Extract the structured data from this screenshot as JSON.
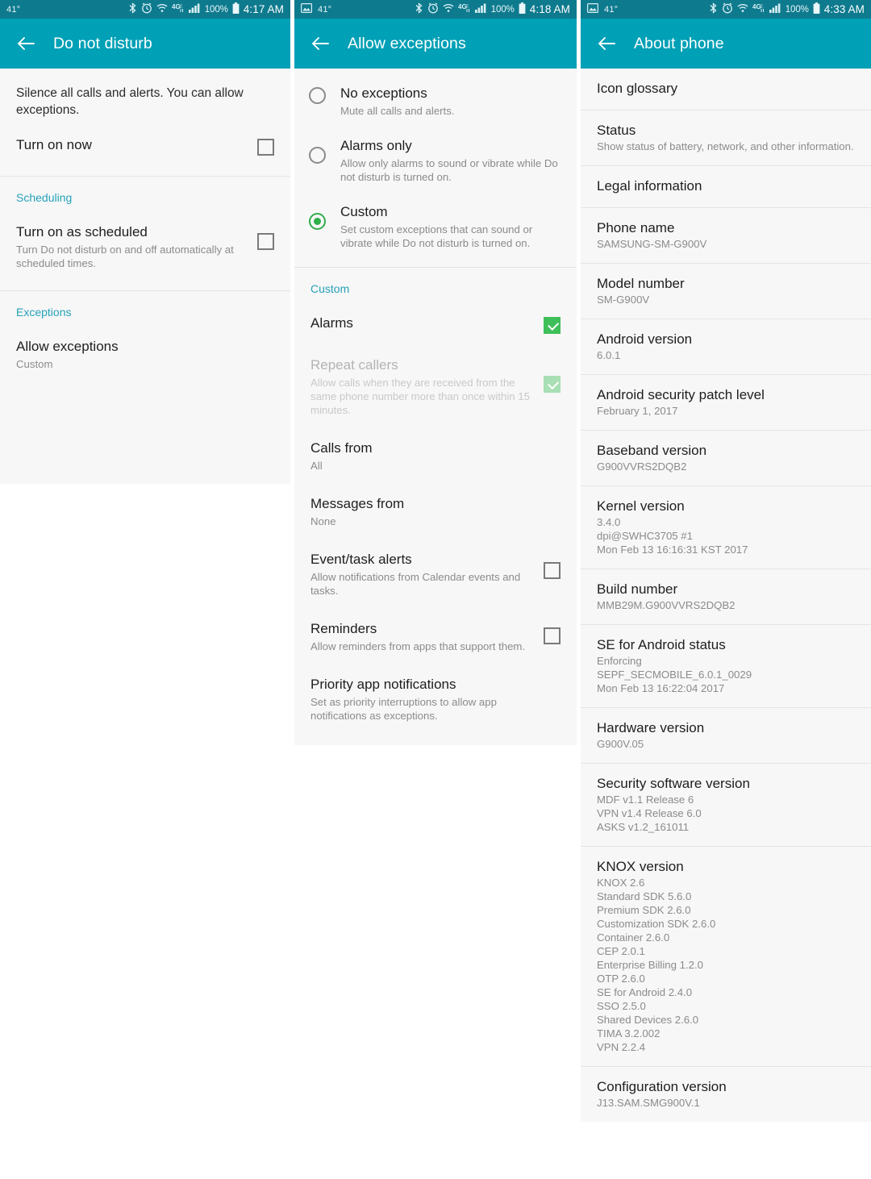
{
  "panels": [
    {
      "statusbar": {
        "temp": "41°",
        "has_image_icon": false,
        "battery_pct": "100%",
        "time": "4:17 AM",
        "icons": [
          "bluetooth-icon",
          "alarm-icon",
          "wifi-icon",
          "4g-lte-icon",
          "signal-icon",
          "battery-icon"
        ]
      },
      "appbar": {
        "title": "Do not disturb",
        "back_label": "←"
      },
      "intro": "Silence all calls and alerts. You can allow exceptions.",
      "rows": [
        {
          "title": "Turn on now",
          "subtitle": "",
          "control": "checkbox",
          "checked": false
        }
      ],
      "sections": [
        {
          "header": "Scheduling",
          "rows": [
            {
              "title": "Turn on as scheduled",
              "subtitle": "Turn Do not disturb on and off automatically at scheduled times.",
              "control": "checkbox",
              "checked": false
            }
          ]
        },
        {
          "header": "Exceptions",
          "rows": [
            {
              "title": "Allow exceptions",
              "subtitle": "Custom",
              "control": "none",
              "checked": false
            }
          ]
        }
      ]
    },
    {
      "statusbar": {
        "temp": "41°",
        "has_image_icon": true,
        "battery_pct": "100%",
        "time": "4:18 AM",
        "icons": [
          "image-icon",
          "bluetooth-icon",
          "alarm-icon",
          "wifi-icon",
          "4g-lte-icon",
          "signal-icon",
          "battery-icon"
        ]
      },
      "appbar": {
        "title": "Allow exceptions",
        "back_label": "←"
      },
      "radios": [
        {
          "title": "No exceptions",
          "subtitle": "Mute all calls and alerts.",
          "selected": false
        },
        {
          "title": "Alarms only",
          "subtitle": "Allow only alarms to sound or vibrate while Do not disturb is turned on.",
          "selected": false
        },
        {
          "title": "Custom",
          "subtitle": "Set custom exceptions that can sound or vibrate while Do not disturb is turned on.",
          "selected": true
        }
      ],
      "custom_header": "Custom",
      "custom_rows": [
        {
          "title": "Alarms",
          "subtitle": "",
          "control": "checkbox",
          "checked": true,
          "disabled": false
        },
        {
          "title": "Repeat callers",
          "subtitle": "Allow calls when they are received from the same phone number more than once within 15 minutes.",
          "control": "checkbox",
          "checked": true,
          "disabled": true
        },
        {
          "title": "Calls from",
          "subtitle": "All",
          "control": "none",
          "checked": false,
          "disabled": false
        },
        {
          "title": "Messages from",
          "subtitle": "None",
          "control": "none",
          "checked": false,
          "disabled": false
        },
        {
          "title": "Event/task alerts",
          "subtitle": "Allow notifications from Calendar events and tasks.",
          "control": "checkbox",
          "checked": false,
          "disabled": false
        },
        {
          "title": "Reminders",
          "subtitle": "Allow reminders from apps that support them.",
          "control": "checkbox",
          "checked": false,
          "disabled": false
        },
        {
          "title": "Priority app notifications",
          "subtitle": "Set as priority interruptions to allow app notifications as exceptions.",
          "control": "none",
          "checked": false,
          "disabled": false
        }
      ]
    },
    {
      "statusbar": {
        "temp": "41°",
        "has_image_icon": true,
        "battery_pct": "100%",
        "time": "4:33 AM",
        "icons": [
          "image-icon",
          "bluetooth-icon",
          "alarm-icon",
          "wifi-icon",
          "4g-lte-icon",
          "signal-icon",
          "battery-icon"
        ]
      },
      "appbar": {
        "title": "About phone",
        "back_label": "←"
      },
      "rows": [
        {
          "title": "Icon glossary",
          "lines": []
        },
        {
          "title": "Status",
          "lines": [
            "Show status of battery, network, and other information."
          ]
        },
        {
          "title": "Legal information",
          "lines": []
        },
        {
          "title": "Phone name",
          "lines": [
            "SAMSUNG-SM-G900V"
          ]
        },
        {
          "title": "Model number",
          "lines": [
            "SM-G900V"
          ]
        },
        {
          "title": "Android version",
          "lines": [
            "6.0.1"
          ]
        },
        {
          "title": "Android security patch level",
          "lines": [
            "February 1, 2017"
          ]
        },
        {
          "title": "Baseband version",
          "lines": [
            "G900VVRS2DQB2"
          ]
        },
        {
          "title": "Kernel version",
          "lines": [
            "3.4.0",
            "dpi@SWHC3705 #1",
            "Mon Feb 13 16:16:31 KST 2017"
          ]
        },
        {
          "title": "Build number",
          "lines": [
            "MMB29M.G900VVRS2DQB2"
          ]
        },
        {
          "title": "SE for Android status",
          "lines": [
            "Enforcing",
            "SEPF_SECMOBILE_6.0.1_0029",
            "Mon Feb 13 16:22:04 2017"
          ]
        },
        {
          "title": "Hardware version",
          "lines": [
            "G900V.05"
          ]
        },
        {
          "title": "Security software version",
          "lines": [
            "MDF v1.1 Release 6",
            "VPN v1.4 Release 6.0",
            "ASKS v1.2_161011"
          ]
        },
        {
          "title": "KNOX version",
          "lines": [
            "KNOX 2.6",
            "Standard SDK 5.6.0",
            "Premium SDK 2.6.0",
            "Customization SDK 2.6.0",
            "Container 2.6.0",
            "CEP 2.0.1",
            "Enterprise Billing 1.2.0",
            "OTP 2.6.0",
            "SE for Android 2.4.0",
            "SSO 2.5.0",
            "Shared Devices 2.6.0",
            "TIMA 3.2.002",
            "VPN 2.2.4"
          ]
        },
        {
          "title": "Configuration version",
          "lines": [
            "J13.SAM.SMG900V.1"
          ]
        }
      ]
    }
  ],
  "colors": {
    "appbar": "#00a0b6",
    "statusbar": "#0e7a8e",
    "accent_teal": "#26a2b8",
    "check_green": "#3fbf5a",
    "radio_green": "#2fae4c",
    "row_bg": "#f7f7f7"
  }
}
